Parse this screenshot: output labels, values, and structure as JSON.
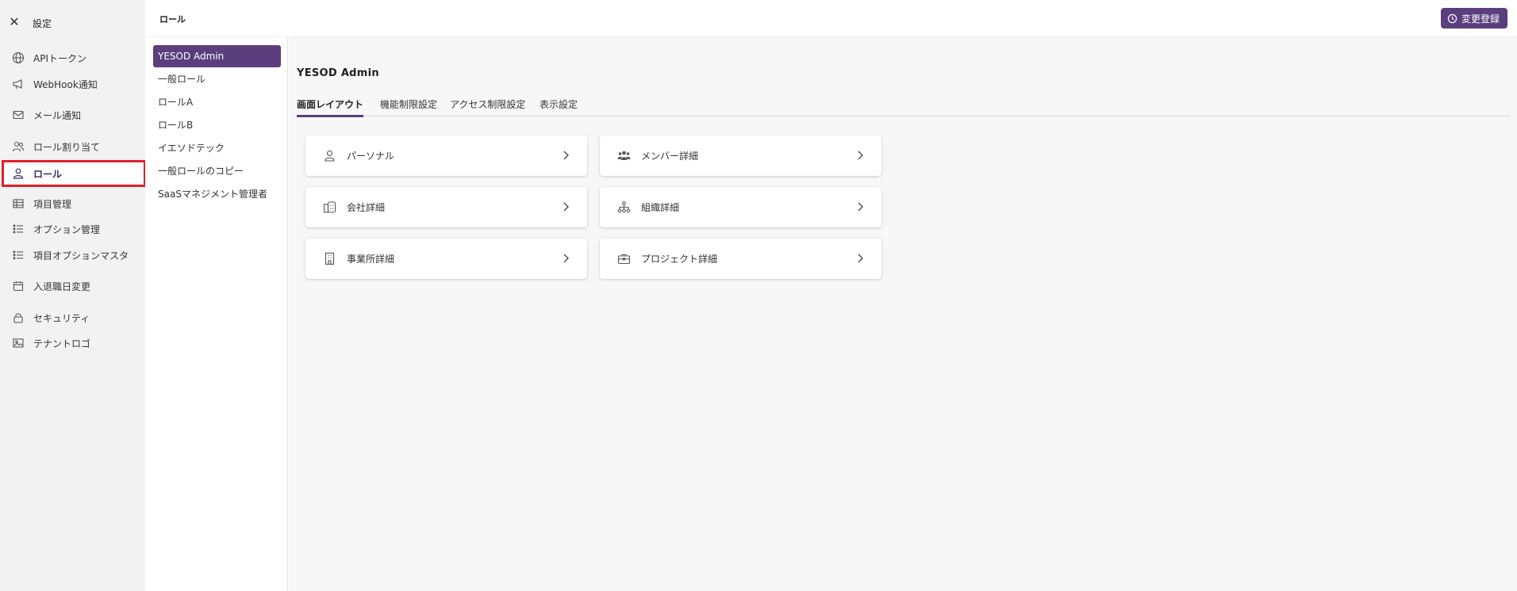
{
  "app": {
    "settings_title": "設定",
    "page_title": "ロール",
    "register_button": "変更登録"
  },
  "nav": {
    "items": [
      {
        "label": "APIトークン",
        "icon": "globe-icon"
      },
      {
        "label": "WebHook通知",
        "icon": "megaphone-icon"
      },
      {
        "label": "メール通知",
        "icon": "mail-icon"
      },
      {
        "label": "ロール割り当て",
        "icon": "users-icon"
      },
      {
        "label": "ロール",
        "icon": "user-icon",
        "active": true
      },
      {
        "label": "項目管理",
        "icon": "table-icon"
      },
      {
        "label": "オプション管理",
        "icon": "list-icon"
      },
      {
        "label": "項目オプションマスタ",
        "icon": "list-icon"
      },
      {
        "label": "入退職日変更",
        "icon": "calendar-icon"
      },
      {
        "label": "セキュリティ",
        "icon": "lock-icon"
      },
      {
        "label": "テナントロゴ",
        "icon": "image-icon"
      }
    ]
  },
  "roles": {
    "items": [
      {
        "label": "YESOD Admin",
        "active": true
      },
      {
        "label": "一般ロール"
      },
      {
        "label": "ロールA"
      },
      {
        "label": "ロールB"
      },
      {
        "label": "イエソドテック"
      },
      {
        "label": "一般ロールのコピー"
      },
      {
        "label": "SaaSマネジメント管理者"
      }
    ]
  },
  "main": {
    "title": "YESOD Admin",
    "tabs": [
      {
        "label": "画面レイアウト",
        "active": true
      },
      {
        "label": "機能制限設定"
      },
      {
        "label": "アクセス制限設定"
      },
      {
        "label": "表示設定"
      }
    ],
    "cards": [
      {
        "label": "パーソナル",
        "icon": "person-icon"
      },
      {
        "label": "メンバー詳細",
        "icon": "members-icon"
      },
      {
        "label": "会社詳細",
        "icon": "company-icon"
      },
      {
        "label": "組織詳細",
        "icon": "org-chart-icon"
      },
      {
        "label": "事業所詳細",
        "icon": "office-building-icon"
      },
      {
        "label": "プロジェクト詳細",
        "icon": "briefcase-icon"
      }
    ]
  },
  "colors": {
    "accent": "#5b3e7e",
    "highlight": "#e0202c"
  }
}
